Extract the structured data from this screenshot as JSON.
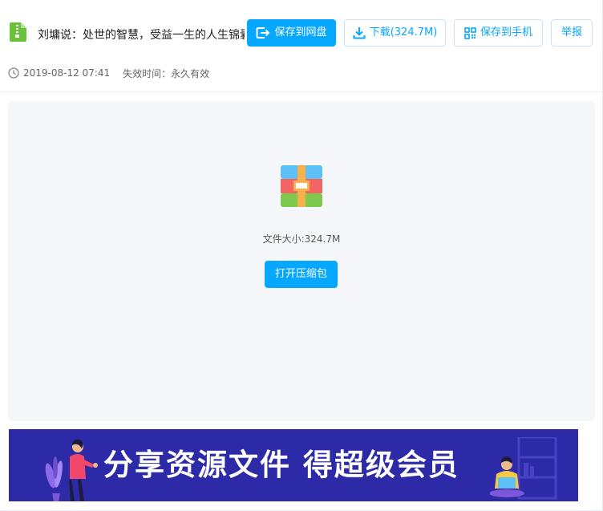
{
  "file": {
    "title": "刘墉说：处世的智慧，受益一生的人生锦囊",
    "date": "2019-08-12 07:41",
    "expire": "失效时间：永久有效",
    "size_label": "文件大小:324.7M"
  },
  "actions": {
    "save_cloud": "保存到网盘",
    "download": "下载(324.7M)",
    "save_phone": "保存到手机",
    "report": "举报",
    "open_zip": "打开压缩包"
  },
  "banner": {
    "text": "分享资源文件 得超级会员"
  },
  "colors": {
    "accent": "#06a7ff",
    "banner_bg": "#2d2aa8",
    "preview_bg": "#f5f7fa"
  },
  "icons": {
    "file_type": "zip-file-icon",
    "save": "save-to-cloud-icon",
    "download": "download-icon",
    "phone": "qr-code-icon",
    "clock": "clock-icon",
    "archive": "archive-icon"
  }
}
